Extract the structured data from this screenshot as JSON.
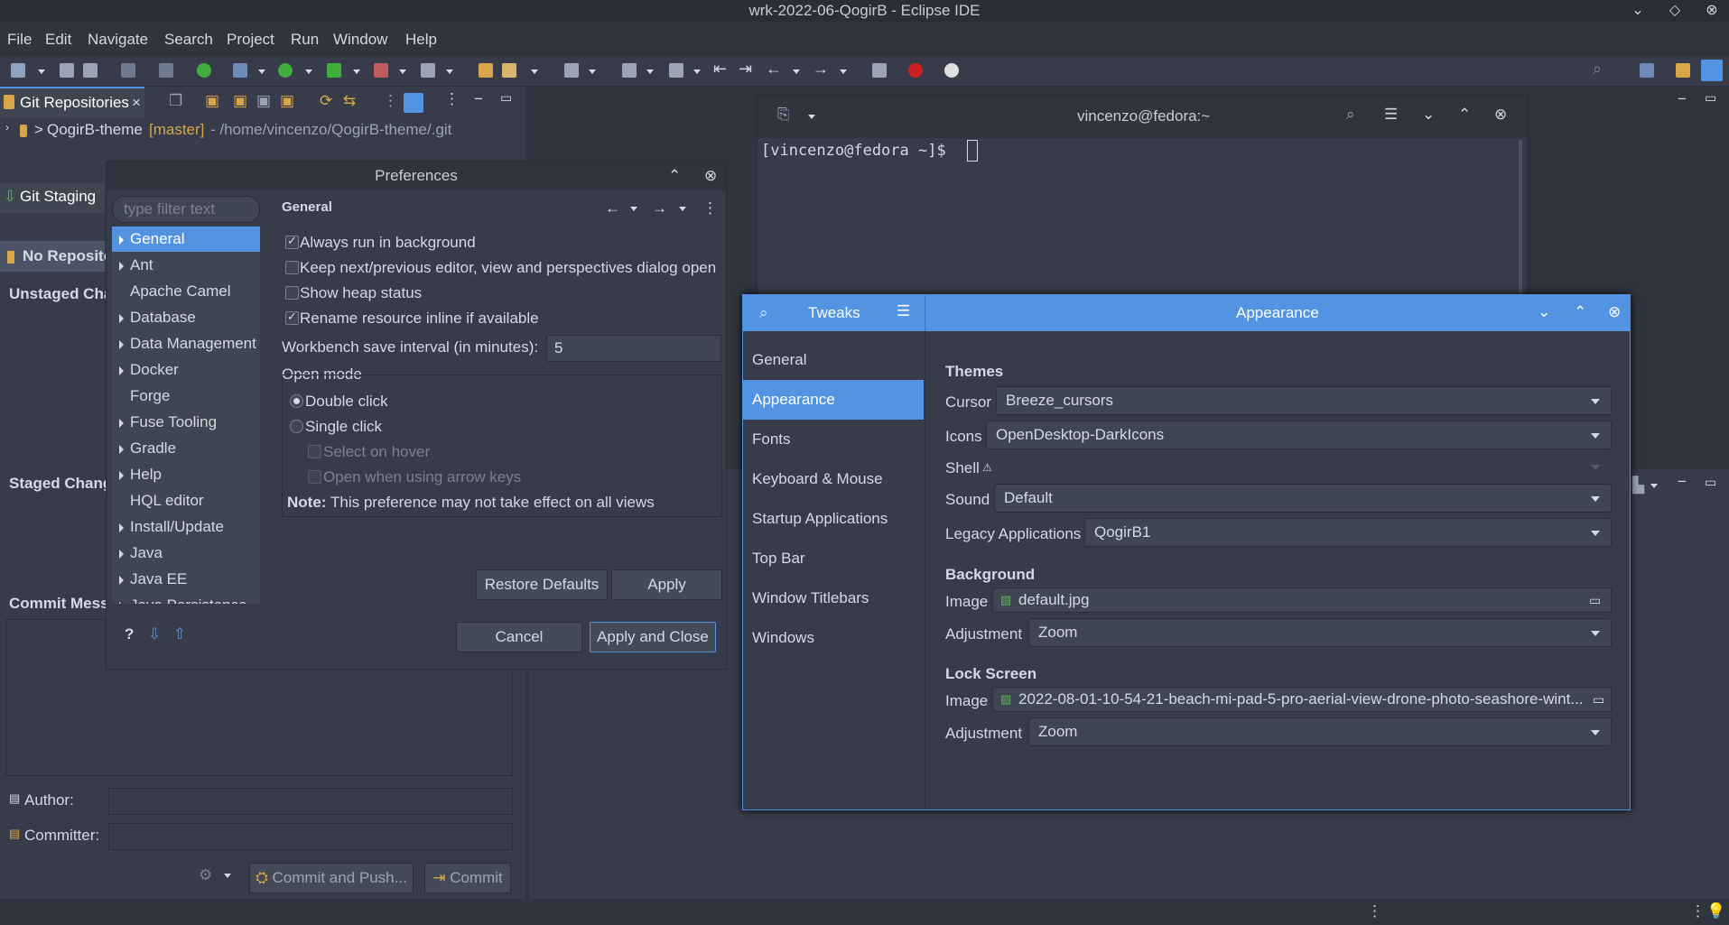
{
  "window": {
    "title": "wrk-2022-06-QogirB - Eclipse IDE"
  },
  "menu": [
    "File",
    "Edit",
    "Navigate",
    "Search",
    "Project",
    "Run",
    "Window",
    "Help"
  ],
  "git_repos": {
    "tab": "Git Repositories",
    "repo_prefix": ">",
    "repo_name": "QogirB-theme",
    "repo_branch": "[master]",
    "repo_path": "- /home/vincenzo/QogirB-theme/.git"
  },
  "git_staging": {
    "tab": "Git Staging",
    "no_repo": "No Reposito",
    "unstaged": "Unstaged Chan",
    "staged": "Staged Chang",
    "commit_msg": "Commit Mess",
    "author_label": "Author:",
    "committer_label": "Committer:",
    "commit_push": "Commit and Push...",
    "commit": "Commit"
  },
  "prefs": {
    "title": "Preferences",
    "filter_placeholder": "type filter text",
    "page_title": "General",
    "tree": [
      {
        "label": "General",
        "arrow": true,
        "selected": true
      },
      {
        "label": "Ant",
        "arrow": true
      },
      {
        "label": "Apache Camel",
        "arrow": false
      },
      {
        "label": "Database",
        "arrow": true
      },
      {
        "label": "Data Management",
        "arrow": true
      },
      {
        "label": "Docker",
        "arrow": true
      },
      {
        "label": "Forge",
        "arrow": false
      },
      {
        "label": "Fuse Tooling",
        "arrow": true
      },
      {
        "label": "Gradle",
        "arrow": true
      },
      {
        "label": "Help",
        "arrow": true
      },
      {
        "label": "HQL editor",
        "arrow": false
      },
      {
        "label": "Install/Update",
        "arrow": true
      },
      {
        "label": "Java",
        "arrow": true
      },
      {
        "label": "Java EE",
        "arrow": true
      },
      {
        "label": "Java Persistence",
        "arrow": true
      }
    ],
    "opt_bg": "Always run in background",
    "opt_keep": "Keep next/previous editor, view and perspectives dialog open",
    "opt_heap": "Show heap status",
    "opt_rename": "Rename resource inline if available",
    "save_interval_label": "Workbench save interval (in minutes):",
    "save_interval_value": "5",
    "open_mode": "Open mode",
    "double_click": "Double click",
    "single_click": "Single click",
    "select_hover": "Select on hover",
    "open_arrow": "Open when using arrow keys",
    "note_bold": "Note:",
    "note_text": "This preference may not take effect on all views",
    "restore": "Restore Defaults",
    "apply": "Apply",
    "cancel": "Cancel",
    "apply_close": "Apply and Close"
  },
  "terminal": {
    "title": "vincenzo@fedora:~",
    "prompt": "[vincenzo@fedora ~]$ "
  },
  "tweaks": {
    "app": "Tweaks",
    "page": "Appearance",
    "nav": [
      "General",
      "Appearance",
      "Fonts",
      "Keyboard & Mouse",
      "Startup Applications",
      "Top Bar",
      "Window Titlebars",
      "Windows"
    ],
    "themes": "Themes",
    "cursor_label": "Cursor",
    "cursor_value": "Breeze_cursors",
    "icons_label": "Icons",
    "icons_value": "OpenDesktop-DarkIcons",
    "shell_label": "Shell",
    "shell_value": "",
    "sound_label": "Sound",
    "sound_value": "Default",
    "legacy_label": "Legacy Applications",
    "legacy_value": "QogirB1",
    "background": "Background",
    "bg_image_label": "Image",
    "bg_image_value": "default.jpg",
    "bg_adj_label": "Adjustment",
    "bg_adj_value": "Zoom",
    "lock": "Lock Screen",
    "lock_image_label": "Image",
    "lock_image_value": "2022-08-01-10-54-21-beach-mi-pad-5-pro-aerial-view-drone-photo-seashore-wint...",
    "lock_adj_label": "Adjustment",
    "lock_adj_value": "Zoom"
  },
  "colors": {
    "accent": "#5294e2",
    "bg": "#2f343f",
    "panel": "#383c4a"
  }
}
